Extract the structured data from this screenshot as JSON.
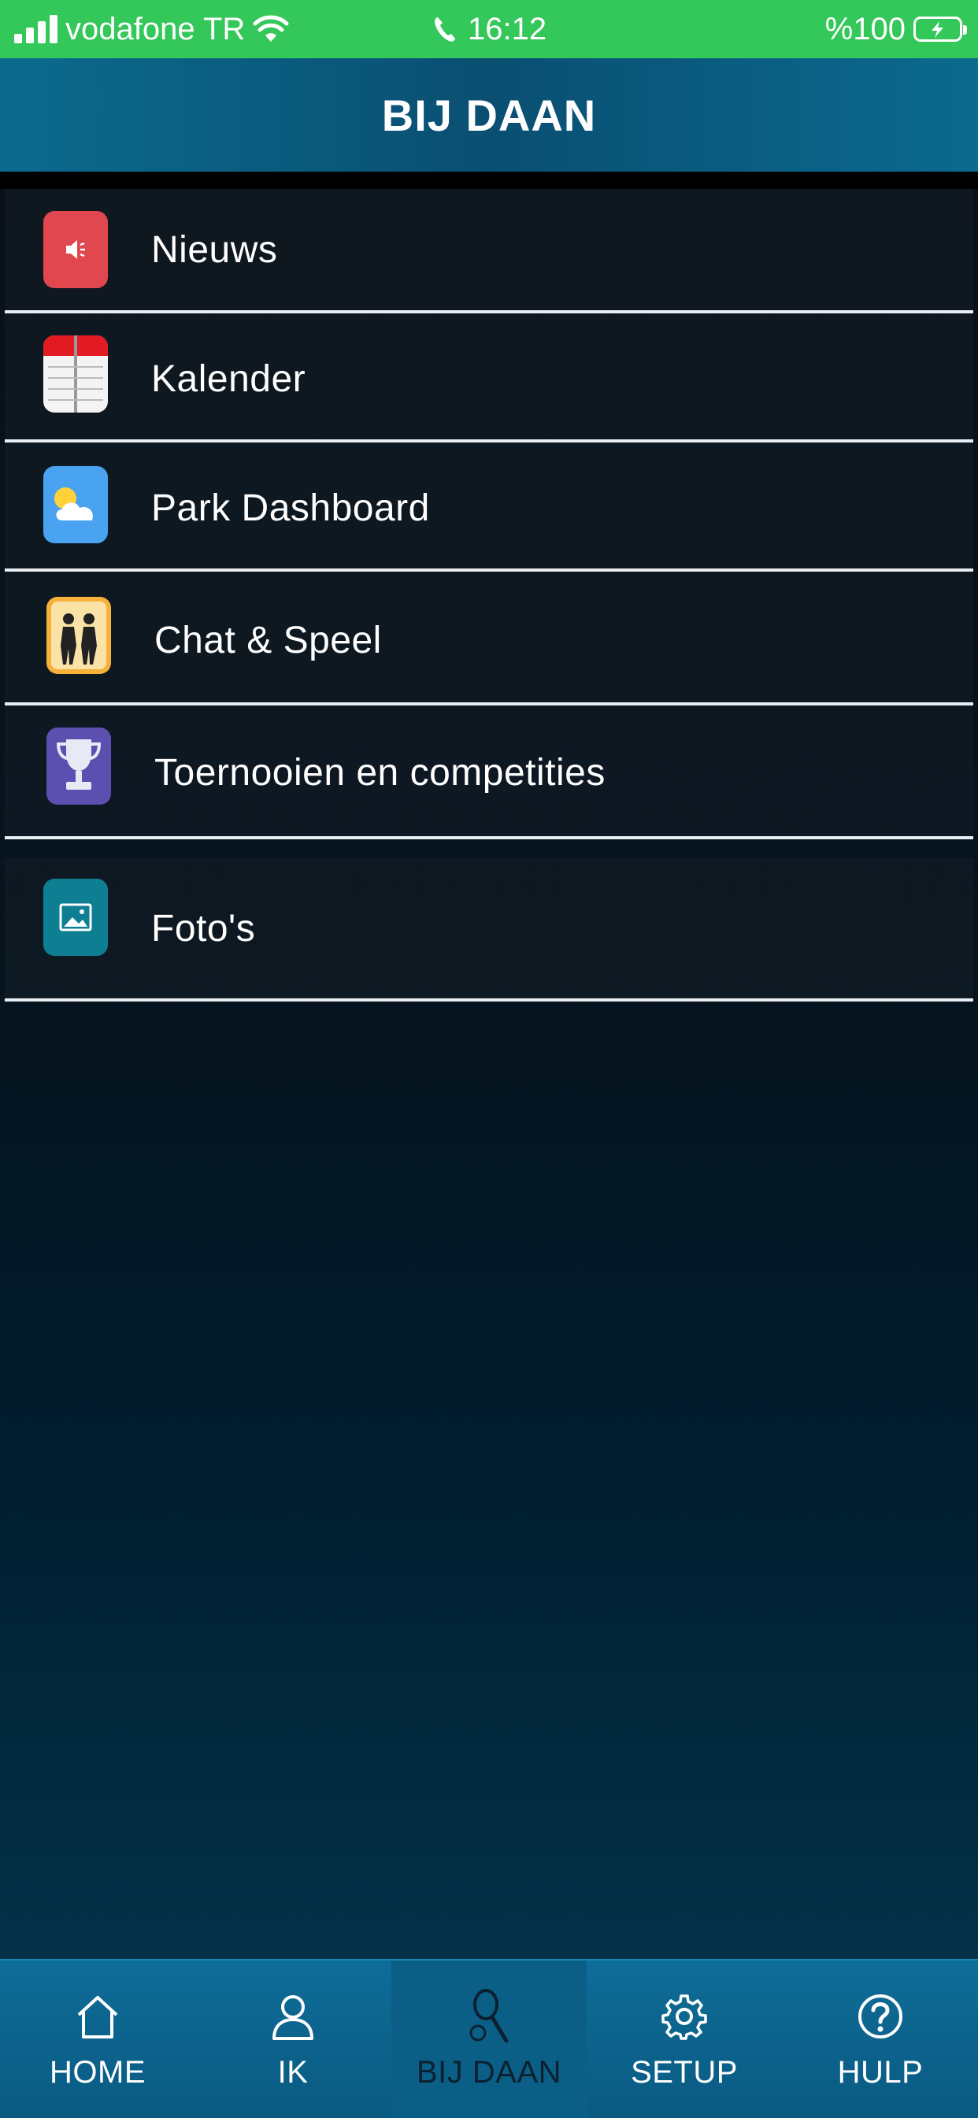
{
  "status_bar": {
    "carrier": "vodafone TR",
    "time": "16:12",
    "battery": "%100"
  },
  "header": {
    "title": "BIJ DAAN"
  },
  "menu": {
    "items": [
      {
        "label": "Nieuws",
        "icon": "speaker-icon",
        "color": "#e0474e"
      },
      {
        "label": "Kalender",
        "icon": "calendar-icon",
        "color": "#ffffff"
      },
      {
        "label": "Park Dashboard",
        "icon": "weather-icon",
        "color": "#4aa3f0"
      },
      {
        "label": "Chat & Speel",
        "icon": "players-icon",
        "color": "#f5b13a"
      },
      {
        "label": "Toernooien en competities",
        "icon": "trophy-icon",
        "color": "#5b50b0"
      },
      {
        "label": "Foto's",
        "icon": "photo-icon",
        "color": "#0e7e93"
      }
    ]
  },
  "tabbar": {
    "tabs": [
      {
        "label": "HOME",
        "icon": "home-icon"
      },
      {
        "label": "IK",
        "icon": "person-icon"
      },
      {
        "label": "BIJ DAAN",
        "icon": "racket-icon",
        "active": true
      },
      {
        "label": "SETUP",
        "icon": "gear-icon"
      },
      {
        "label": "HULP",
        "icon": "help-icon"
      }
    ]
  }
}
